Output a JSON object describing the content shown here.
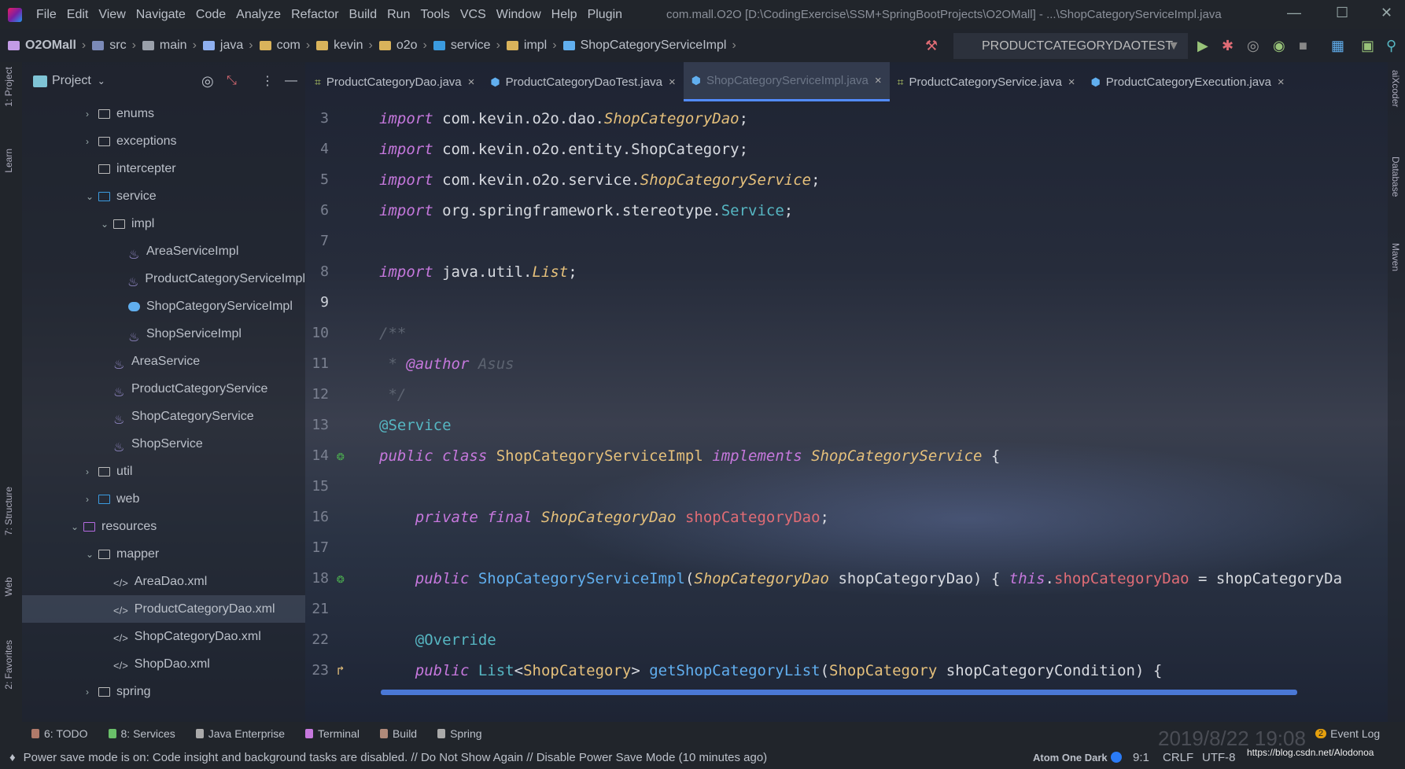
{
  "title": {
    "menu": [
      "File",
      "Edit",
      "View",
      "Navigate",
      "Code",
      "Analyze",
      "Refactor",
      "Build",
      "Run",
      "Tools",
      "VCS",
      "Window",
      "Help",
      "Plugin"
    ],
    "window_title": "com.mall.O2O [D:\\CodingExercise\\SSM+SpringBootProjects\\O2OMall] - ...\\ShopCategoryServiceImpl.java",
    "minimize": "—",
    "maximize": "☐",
    "close": "✕"
  },
  "breadcrumb": {
    "project": "O2OMall",
    "items": [
      "src",
      "main",
      "java",
      "com",
      "kevin",
      "o2o",
      "service",
      "impl",
      "ShopCategoryServiceImpl"
    ]
  },
  "toolbar": {
    "run_config": "PRODUCTCATEGORYDAOTEST"
  },
  "project_panel": {
    "title": "Project",
    "tree": [
      {
        "label": "enums",
        "level": 1,
        "chev": "›",
        "kind": "folder"
      },
      {
        "label": "exceptions",
        "level": 1,
        "chev": "›",
        "kind": "folder"
      },
      {
        "label": "intercepter",
        "level": 1,
        "chev": "",
        "kind": "folder"
      },
      {
        "label": "service",
        "level": 1,
        "chev": "⌄",
        "kind": "pkg"
      },
      {
        "label": "impl",
        "level": 2,
        "chev": "⌄",
        "kind": "folder"
      },
      {
        "label": "AreaServiceImpl",
        "level": 3,
        "chev": "",
        "kind": "java"
      },
      {
        "label": "ProductCategoryServiceImpl",
        "level": 3,
        "chev": "",
        "kind": "java"
      },
      {
        "label": "ShopCategoryServiceImpl",
        "level": 3,
        "chev": "",
        "kind": "class"
      },
      {
        "label": "ShopServiceImpl",
        "level": 3,
        "chev": "",
        "kind": "java"
      },
      {
        "label": "AreaService",
        "level": 2,
        "chev": "",
        "kind": "java"
      },
      {
        "label": "ProductCategoryService",
        "level": 2,
        "chev": "",
        "kind": "java"
      },
      {
        "label": "ShopCategoryService",
        "level": 2,
        "chev": "",
        "kind": "java"
      },
      {
        "label": "ShopService",
        "level": 2,
        "chev": "",
        "kind": "java"
      },
      {
        "label": "util",
        "level": 1,
        "chev": "›",
        "kind": "folder"
      },
      {
        "label": "web",
        "level": 1,
        "chev": "›",
        "kind": "pkg"
      },
      {
        "label": "resources",
        "level": 0,
        "chev": "⌄",
        "kind": "res"
      },
      {
        "label": "mapper",
        "level": 1,
        "chev": "⌄",
        "kind": "folder"
      },
      {
        "label": "AreaDao.xml",
        "level": 2,
        "chev": "",
        "kind": "xml"
      },
      {
        "label": "ProductCategoryDao.xml",
        "level": 2,
        "chev": "",
        "kind": "xml",
        "selected": true
      },
      {
        "label": "ShopCategoryDao.xml",
        "level": 2,
        "chev": "",
        "kind": "xml"
      },
      {
        "label": "ShopDao.xml",
        "level": 2,
        "chev": "",
        "kind": "xml"
      },
      {
        "label": "spring",
        "level": 1,
        "chev": "›",
        "kind": "folder"
      }
    ]
  },
  "left_strip": [
    "1: Project",
    "Learn",
    "7: Structure",
    "Web",
    "2: Favorites"
  ],
  "right_strip": [
    "aiXcoder",
    "Database",
    "Maven"
  ],
  "tabs": [
    {
      "label": "ProductCategoryDao.java"
    },
    {
      "label": "ProductCategoryDaoTest.java"
    },
    {
      "label": "ShopCategoryServiceImpl.java",
      "active": true
    },
    {
      "label": "ProductCategoryService.java"
    },
    {
      "label": "ProductCategoryExecution.java"
    }
  ],
  "code": [
    {
      "n": "3",
      "t": [
        [
          "kw",
          "import "
        ],
        [
          "pl",
          "com.kevin.o2o.dao."
        ],
        [
          "ty",
          "ShopCategoryDao"
        ],
        [
          "pl",
          ";"
        ]
      ]
    },
    {
      "n": "4",
      "t": [
        [
          "kw",
          "import "
        ],
        [
          "pl",
          "com.kevin.o2o.entity.ShopCategory;"
        ]
      ]
    },
    {
      "n": "5",
      "t": [
        [
          "kw",
          "import "
        ],
        [
          "pl",
          "com.kevin.o2o.service."
        ],
        [
          "ty",
          "ShopCategoryService"
        ],
        [
          "pl",
          ";"
        ]
      ]
    },
    {
      "n": "6",
      "t": [
        [
          "kw",
          "import "
        ],
        [
          "pl",
          "org.springframework.stereotype."
        ],
        [
          "cy",
          "Service"
        ],
        [
          "pl",
          ";"
        ]
      ]
    },
    {
      "n": "7",
      "t": []
    },
    {
      "n": "8",
      "t": [
        [
          "kw",
          "import "
        ],
        [
          "pl",
          "java.util."
        ],
        [
          "ty",
          "List"
        ],
        [
          "pl",
          ";"
        ]
      ]
    },
    {
      "n": "9",
      "t": []
    },
    {
      "n": "10",
      "t": [
        [
          "cm",
          "/**"
        ]
      ]
    },
    {
      "n": "11",
      "t": [
        [
          "cm",
          " * "
        ],
        [
          "kw",
          "@author "
        ],
        [
          "cm",
          "Asus"
        ]
      ]
    },
    {
      "n": "12",
      "t": [
        [
          "cm",
          " */"
        ]
      ]
    },
    {
      "n": "13",
      "t": [
        [
          "cy",
          "@Service"
        ]
      ]
    },
    {
      "n": "14",
      "t": [
        [
          "kw",
          "public class "
        ],
        [
          "yl",
          "ShopCategoryServiceImpl "
        ],
        [
          "kw",
          "implements "
        ],
        [
          "ty",
          "ShopCategoryService "
        ],
        [
          "pl",
          "{"
        ]
      ]
    },
    {
      "n": "15",
      "t": []
    },
    {
      "n": "16",
      "t": [
        [
          "pl",
          "    "
        ],
        [
          "kw",
          "private final "
        ],
        [
          "ty",
          "ShopCategoryDao "
        ],
        [
          "rd",
          "shopCategoryDao"
        ],
        [
          "pl",
          ";"
        ]
      ]
    },
    {
      "n": "17",
      "t": []
    },
    {
      "n": "18",
      "t": [
        [
          "pl",
          "    "
        ],
        [
          "kw",
          "public "
        ],
        [
          "bl",
          "ShopCategoryServiceImpl"
        ],
        [
          "pl",
          "("
        ],
        [
          "ty",
          "ShopCategoryDao "
        ],
        [
          "pl",
          "shopCategoryDao) { "
        ],
        [
          "kw",
          "this"
        ],
        [
          "pl",
          "."
        ],
        [
          "rd",
          "shopCategoryDao"
        ],
        [
          "pl",
          " = shopCategoryDa"
        ]
      ]
    },
    {
      "n": "21",
      "t": []
    },
    {
      "n": "22",
      "t": [
        [
          "pl",
          "    "
        ],
        [
          "cy",
          "@Override"
        ]
      ]
    },
    {
      "n": "23",
      "t": [
        [
          "pl",
          "    "
        ],
        [
          "kw",
          "public "
        ],
        [
          "cy",
          "List"
        ],
        [
          "pl",
          "<"
        ],
        [
          "yl",
          "ShopCategory"
        ],
        [
          "pl",
          "> "
        ],
        [
          "bl",
          "getShopCategoryList"
        ],
        [
          "pl",
          "("
        ],
        [
          "yl",
          "ShopCategory "
        ],
        [
          "pl",
          "shopCategoryCondition) {"
        ]
      ]
    }
  ],
  "bottom_tabs": [
    "6: TODO",
    "8: Services",
    "Java Enterprise",
    "Terminal",
    "Build",
    "Spring"
  ],
  "event_log": {
    "count": "2",
    "label": "Event Log"
  },
  "status": {
    "message": "Power save mode is on: Code insight and background tasks are disabled. // Do Not Show Again // Disable Power Save Mode (10 minutes ago)",
    "theme": "Atom One Dark",
    "position": "9:1",
    "line_sep": "CRLF",
    "encoding": "UTF-8",
    "watermark": "https://blog.csdn.net/Alodonoa",
    "date_overlay": "2019/8/22 19:08"
  },
  "colors": {
    "accent": "#528bff",
    "keyword": "#c678dd",
    "type": "#e5c07b",
    "field": "#e06c75",
    "method": "#61afef"
  }
}
